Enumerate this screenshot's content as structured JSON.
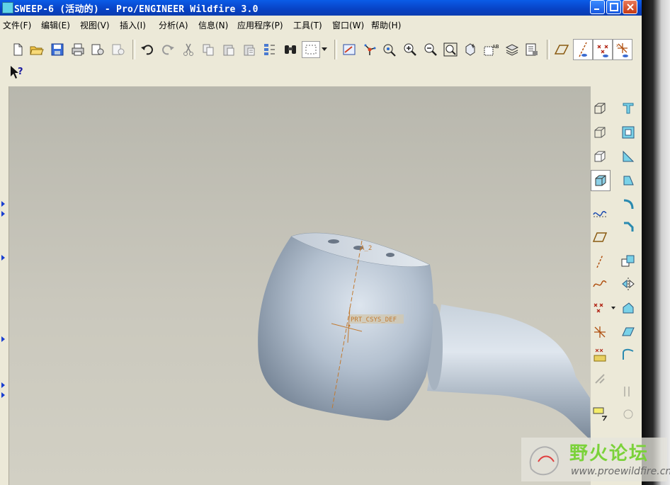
{
  "window": {
    "title": "SWEEP-6 (活动的) - Pro/ENGINEER Wildfire 3.0"
  },
  "menu": [
    "文件(F)",
    "编辑(E)",
    "视图(V)",
    "插入(I)",
    "分析(A)",
    "信息(N)",
    "应用程序(P)",
    "工具(T)",
    "窗口(W)",
    "帮助(H)"
  ],
  "model": {
    "axis_label": "A_2",
    "csys_label": "PRT_CSYS_DEF"
  },
  "watermark": {
    "brand": "野火论坛",
    "url": "www.proewildfire.cn"
  },
  "toolbar_icons": [
    "new-file-icon",
    "open-folder-icon",
    "save-icon",
    "print-icon",
    "send-mail-icon",
    "mail-recipient-icon",
    "undo-icon",
    "redo-icon",
    "cut-icon",
    "copy-icon",
    "paste-icon",
    "paste-special-icon",
    "regenerate-icon",
    "find-icon",
    "selection-box-icon",
    "repaint-icon",
    "spin-center-icon",
    "orient-mode-icon",
    "zoom-in-icon",
    "zoom-out-icon",
    "refit-icon",
    "reorient-icon",
    "saved-views-icon",
    "layers-icon",
    "view-manager-icon",
    "datum-planes-toggle-icon",
    "datum-axes-toggle-icon",
    "datum-points-toggle-icon",
    "csys-toggle-icon",
    "context-help-icon"
  ],
  "right_icons": [
    "wireframe-icon",
    "hidden-line-icon",
    "no-hidden-icon",
    "shading-icon",
    "sketch-curve-tool-icon",
    "datum-plane-tool-icon",
    "datum-axis-tool-icon",
    "datum-curve-tool-icon",
    "datum-point-tool-icon",
    "csys-tool-icon",
    "analysis-feature-icon",
    "insert-annotation-icon",
    "hole-tool-icon",
    "shell-tool-icon",
    "rib-tool-icon",
    "draft-tool-icon",
    "round-tool-icon",
    "chamfer-tool-icon",
    "copy-tool-icon",
    "mirror-tool-icon",
    "merge-tool-icon",
    "trim-tool-icon",
    "extend-tool-icon"
  ]
}
